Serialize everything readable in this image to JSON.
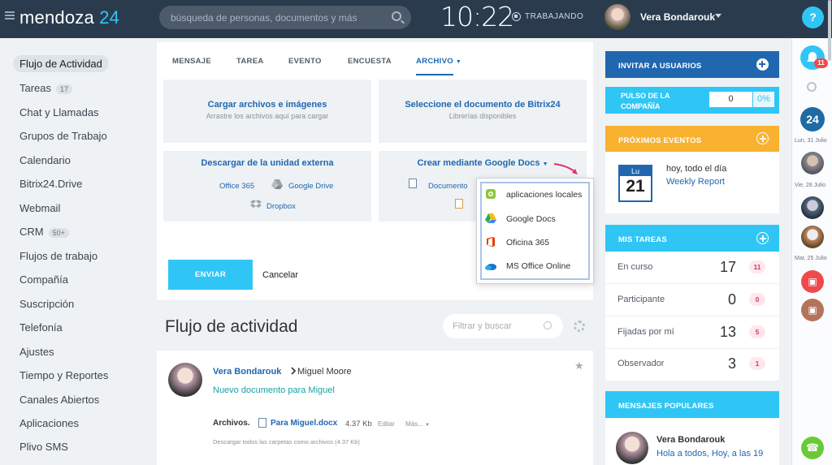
{
  "app": {
    "logo_word": "mendoza",
    "logo_num": "24"
  },
  "header": {
    "search_placeholder": "búsqueda de personas, documentos y más",
    "clock": "10:22",
    "status": "TRABAJANDO",
    "user_name": "Vera Bondarouk"
  },
  "sidebar": {
    "items": [
      {
        "label": "Flujo de Actividad"
      },
      {
        "label": "Tareas",
        "counter": "17"
      },
      {
        "label": "Chat y Llamadas"
      },
      {
        "label": "Grupos de Trabajo"
      },
      {
        "label": "Calendario"
      },
      {
        "label": "Bitrix24.Drive"
      },
      {
        "label": "Webmail"
      },
      {
        "label": "CRM",
        "counter": "50+"
      },
      {
        "label": "Flujos de trabajo"
      },
      {
        "label": "Compañía"
      },
      {
        "label": "Suscripción"
      },
      {
        "label": "Telefonía"
      },
      {
        "label": "Ajustes"
      },
      {
        "label": "Tiempo y Reportes"
      },
      {
        "label": "Canales Abiertos"
      },
      {
        "label": "Aplicaciones"
      },
      {
        "label": "Plivo SMS"
      }
    ]
  },
  "composer": {
    "tabs": [
      "MENSAJE",
      "TAREA",
      "EVENTO",
      "ENCUESTA",
      "ARCHIVO"
    ],
    "cards": {
      "upload_title": "Cargar archivos e imágenes",
      "upload_sub": "Arrastre los archivos aquí para cargar",
      "select_title": "Seleccione el documento de Bitrix24",
      "select_sub": "Librerías disponibles",
      "external_title": "Descargar de la unidad externa",
      "office365": "Office 365",
      "google_drive": "Google Drive",
      "dropbox": "Dropbox",
      "google_docs_title": "Crear mediante Google Docs",
      "documento": "Documento"
    },
    "popup": [
      "aplicaciones locales",
      "Google Docs",
      "Oficina 365",
      "MS Office Online"
    ],
    "send": "ENVIAR",
    "cancel": "Cancelar"
  },
  "stream": {
    "title": "Flujo de actividad",
    "filter_placeholder": "Filtrar y buscar",
    "post": {
      "author": "Vera Bondarouk",
      "target": "Miguel Moore",
      "title": "Nuevo documento para Miguel",
      "files_label": "Archivos.",
      "file_name": "Para Miguel.docx",
      "file_size": "4.37 Kb",
      "edit": "Editar",
      "more": "Más...",
      "download_all": "Descargar todos las carpetas como archivos (4.37 Kb)"
    }
  },
  "right": {
    "invite": "INVITAR A USUARIOS",
    "pulse_label": "PULSO DE LA COMPAÑÍA",
    "pulse_value": "0",
    "pulse_pct": "0%",
    "events_header": "PRÓXIMOS EVENTOS",
    "cal_dow": "Lu",
    "cal_day": "21",
    "event_time": "hoy, todo el día",
    "event_name": "Weekly Report",
    "tasks_header": "MIS TAREAS",
    "tasks": [
      {
        "label": "En curso",
        "count": "17",
        "badge": "11"
      },
      {
        "label": "Participante",
        "count": "0",
        "badge": "0"
      },
      {
        "label": "Fijadas por mí",
        "count": "13",
        "badge": "5"
      },
      {
        "label": "Observador",
        "count": "3",
        "badge": "1"
      }
    ],
    "popular_header": "MENSAJES POPULARES",
    "popular_author": "Vera Bondarouk",
    "popular_text": "Hola a todos, Hoy, a las 19"
  },
  "rail": {
    "help": "?",
    "notif_count": "11",
    "b24": "24",
    "dates": [
      "Lun, 31 Julio",
      "Vie, 28 Julio",
      "Mar, 25 Julio"
    ]
  },
  "colors": {
    "accent": "#2fc6f6",
    "link": "#2067b0",
    "events": "#f8b230",
    "topbar": "#2a3b4e"
  }
}
